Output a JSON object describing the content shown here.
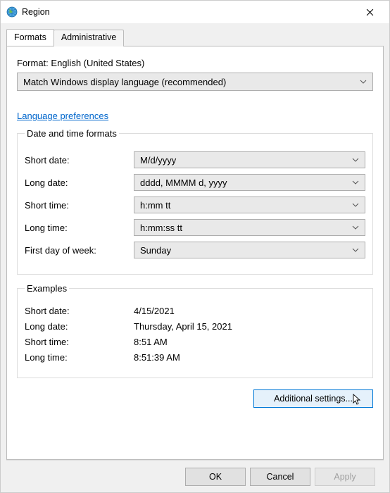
{
  "window": {
    "title": "Region"
  },
  "tabs": {
    "formats": "Formats",
    "administrative": "Administrative"
  },
  "format_label_prefix": "Format: ",
  "format_label_value": "English (United States)",
  "format_combo": "Match Windows display language (recommended)",
  "link": "Language preferences",
  "groups": {
    "dtf_legend": "Date and time formats",
    "examples_legend": "Examples"
  },
  "labels": {
    "short_date": "Short date:",
    "long_date": "Long date:",
    "short_time": "Short time:",
    "long_time": "Long time:",
    "first_dow": "First day of week:"
  },
  "values": {
    "short_date": "M/d/yyyy",
    "long_date": "dddd, MMMM d, yyyy",
    "short_time": "h:mm tt",
    "long_time": "h:mm:ss tt",
    "first_dow": "Sunday"
  },
  "examples": {
    "short_date": "4/15/2021",
    "long_date": "Thursday, April 15, 2021",
    "short_time": "8:51 AM",
    "long_time": "8:51:39 AM"
  },
  "buttons": {
    "additional": "Additional settings...",
    "ok": "OK",
    "cancel": "Cancel",
    "apply": "Apply"
  }
}
